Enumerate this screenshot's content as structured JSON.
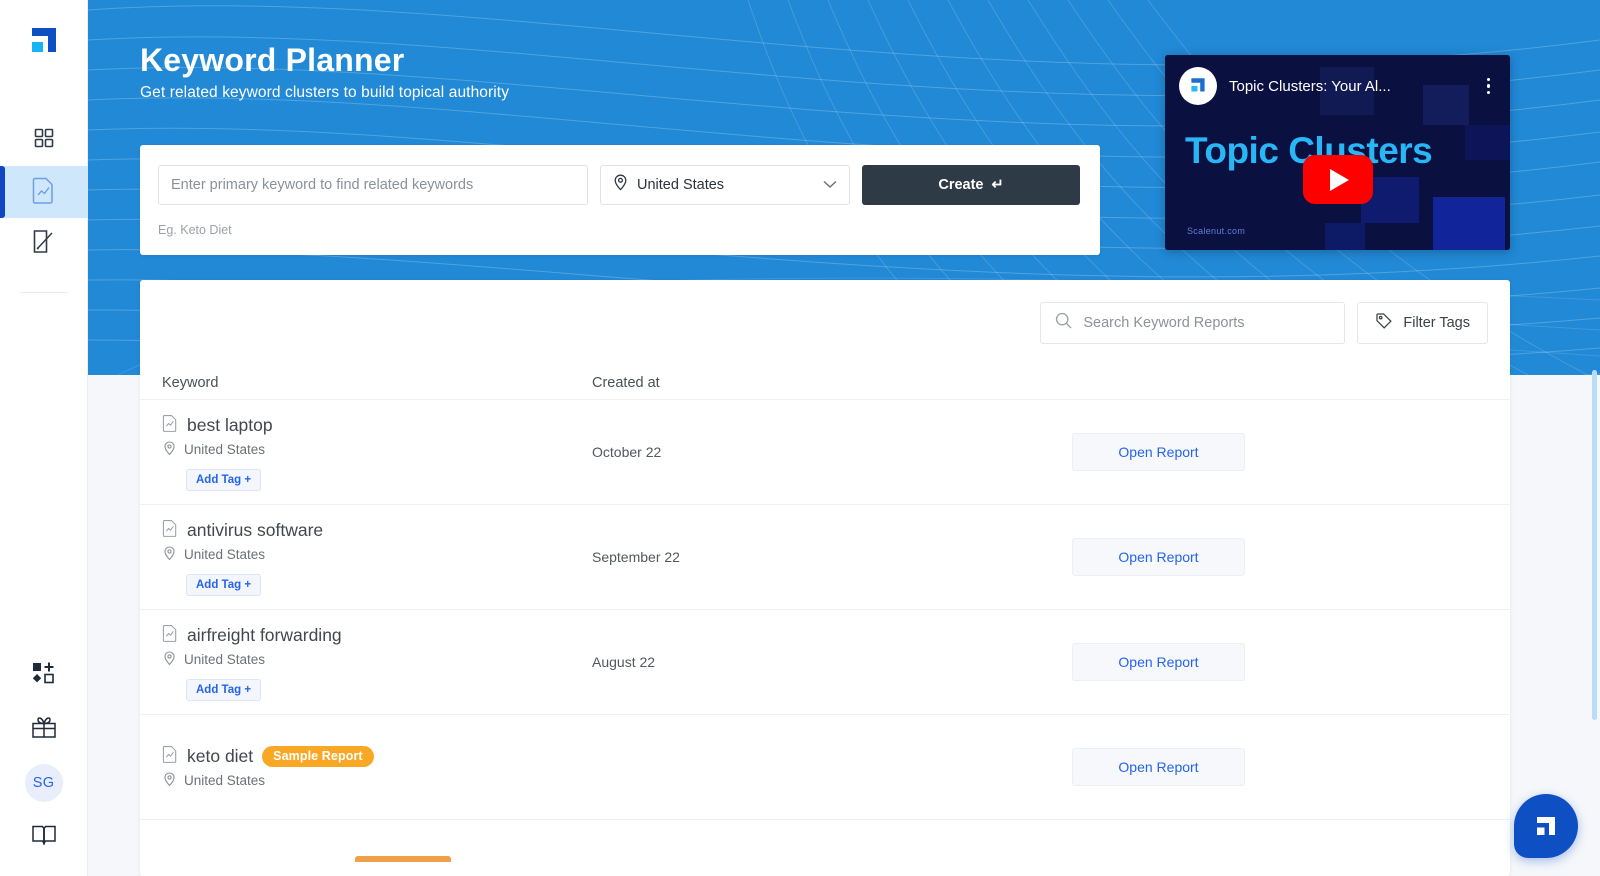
{
  "app": {
    "brand_blue": "#2189d6",
    "accent_blue": "#2563eb",
    "dark_button": "#2f3a47",
    "badge_orange": "#f9a825"
  },
  "sidebar": {
    "logo_name": "scalenut-logo",
    "items": [
      {
        "id": "dashboard",
        "icon": "grid-icon",
        "active": false
      },
      {
        "id": "keyword-planner",
        "icon": "report-chart-icon",
        "active": true
      },
      {
        "id": "content-editor",
        "icon": "edit-document-icon",
        "active": false
      }
    ],
    "bottom_items": [
      {
        "id": "integrations",
        "icon": "shapes-plus-icon"
      },
      {
        "id": "rewards",
        "icon": "gift-icon"
      },
      {
        "id": "docs",
        "icon": "open-book-icon"
      }
    ],
    "avatar_initials": "SG"
  },
  "hero": {
    "title": "Keyword Planner",
    "subtitle": "Get related keyword clusters to build topical authority"
  },
  "search_form": {
    "keyword_placeholder": "Enter primary keyword to find related keywords",
    "keyword_value": "",
    "country_value": "United States",
    "country_icon": "location-pin-icon",
    "chevron_icon": "chevron-down-icon",
    "create_label": "Create",
    "create_glyph": "↵",
    "hint": "Eg. Keto Diet"
  },
  "video": {
    "title": "Topic Clusters: Your Al...",
    "heading": "Topic Clusters",
    "watermark": "Scalenut.com",
    "channel_icon": "scalenut-channel-avatar",
    "menu_icon": "kebab-menu-icon",
    "play_icon": "youtube-play-icon"
  },
  "reports": {
    "search_placeholder": "Search Keyword Reports",
    "search_value": "",
    "search_icon": "search-icon",
    "filter_label": "Filter Tags",
    "filter_icon": "tag-icon",
    "columns": {
      "keyword": "Keyword",
      "created_at": "Created at"
    },
    "open_report_label": "Open Report",
    "add_tag_label": "Add Tag +",
    "rows": [
      {
        "keyword": "best laptop",
        "location": "United States",
        "created_at": "October 22",
        "has_add_tag": true,
        "badge": null
      },
      {
        "keyword": "antivirus software",
        "location": "United States",
        "created_at": "September 22",
        "has_add_tag": true,
        "badge": null
      },
      {
        "keyword": "airfreight forwarding",
        "location": "United States",
        "created_at": "August 22",
        "has_add_tag": true,
        "badge": null
      },
      {
        "keyword": "keto diet",
        "location": "United States",
        "created_at": "",
        "has_add_tag": false,
        "badge": "Sample Report"
      }
    ]
  },
  "fab": {
    "icon": "scalenut-chat-logo-icon"
  }
}
